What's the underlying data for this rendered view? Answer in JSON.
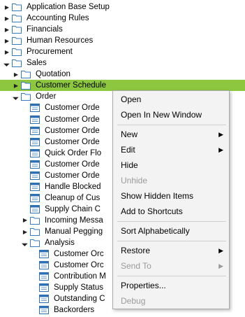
{
  "tree": [
    {
      "label": "Application Base Setup",
      "level": 0,
      "toggle": "collapsed",
      "icon": "folder"
    },
    {
      "label": "Accounting Rules",
      "level": 0,
      "toggle": "collapsed",
      "icon": "folder"
    },
    {
      "label": "Financials",
      "level": 0,
      "toggle": "collapsed",
      "icon": "folder"
    },
    {
      "label": "Human Resources",
      "level": 0,
      "toggle": "collapsed",
      "icon": "folder"
    },
    {
      "label": "Procurement",
      "level": 0,
      "toggle": "collapsed",
      "icon": "folder"
    },
    {
      "label": "Sales",
      "level": 0,
      "toggle": "expanded",
      "icon": "folder"
    },
    {
      "label": "Quotation",
      "level": 1,
      "toggle": "collapsed",
      "icon": "folder"
    },
    {
      "label": "Customer Schedule",
      "level": 1,
      "toggle": "collapsed",
      "icon": "folder",
      "selected": true
    },
    {
      "label": "Order",
      "level": 1,
      "toggle": "expanded",
      "icon": "folder"
    },
    {
      "label": "Customer Orde",
      "level": 2,
      "toggle": "none",
      "icon": "window"
    },
    {
      "label": "Customer Orde",
      "level": 2,
      "toggle": "none",
      "icon": "window"
    },
    {
      "label": "Customer Orde",
      "level": 2,
      "toggle": "none",
      "icon": "window"
    },
    {
      "label": "Customer Orde",
      "level": 2,
      "toggle": "none",
      "icon": "window"
    },
    {
      "label": "Quick Order Flo",
      "level": 2,
      "toggle": "none",
      "icon": "window"
    },
    {
      "label": "Customer Orde",
      "level": 2,
      "toggle": "none",
      "icon": "window"
    },
    {
      "label": "Customer Orde",
      "level": 2,
      "toggle": "none",
      "icon": "window"
    },
    {
      "label": "Handle Blocked",
      "level": 2,
      "toggle": "none",
      "icon": "window"
    },
    {
      "label": "Cleanup of Cus",
      "level": 2,
      "toggle": "none",
      "icon": "window"
    },
    {
      "label": "Supply Chain C",
      "level": 2,
      "toggle": "none",
      "icon": "window"
    },
    {
      "label": "Incoming Messa",
      "level": 2,
      "toggle": "collapsed",
      "icon": "folder"
    },
    {
      "label": "Manual Pegging",
      "level": 2,
      "toggle": "collapsed",
      "icon": "folder"
    },
    {
      "label": "Analysis",
      "level": 2,
      "toggle": "expanded",
      "icon": "folder"
    },
    {
      "label": "Customer Orc",
      "level": 3,
      "toggle": "none",
      "icon": "window"
    },
    {
      "label": "Customer Orc",
      "level": 3,
      "toggle": "none",
      "icon": "window"
    },
    {
      "label": "Contribution M",
      "level": 3,
      "toggle": "none",
      "icon": "window"
    },
    {
      "label": "Supply Status",
      "level": 3,
      "toggle": "none",
      "icon": "window"
    },
    {
      "label": "Outstanding C",
      "level": 3,
      "toggle": "none",
      "icon": "window"
    },
    {
      "label": "Backorders",
      "level": 3,
      "toggle": "none",
      "icon": "window"
    }
  ],
  "menu": [
    {
      "label": "Open",
      "disabled": false,
      "submenu": false
    },
    {
      "label": "Open In New Window",
      "disabled": false,
      "submenu": false
    },
    {
      "sep": true
    },
    {
      "label": "New",
      "disabled": false,
      "submenu": true
    },
    {
      "label": "Edit",
      "disabled": false,
      "submenu": true
    },
    {
      "label": "Hide",
      "disabled": false,
      "submenu": false
    },
    {
      "label": "Unhide",
      "disabled": true,
      "submenu": false
    },
    {
      "label": "Show Hidden Items",
      "disabled": false,
      "submenu": false
    },
    {
      "label": "Add to Shortcuts",
      "disabled": false,
      "submenu": false
    },
    {
      "sep": true
    },
    {
      "label": "Sort Alphabetically",
      "disabled": false,
      "submenu": false
    },
    {
      "sep": true
    },
    {
      "label": "Restore",
      "disabled": false,
      "submenu": true
    },
    {
      "label": "Send To",
      "disabled": true,
      "submenu": true
    },
    {
      "sep": true
    },
    {
      "label": "Properties...",
      "disabled": false,
      "submenu": false
    },
    {
      "label": "Debug",
      "disabled": true,
      "submenu": false
    }
  ],
  "colors": {
    "selection": "#8dc63f",
    "folder_stroke": "#3a7bbf",
    "window_header": "#2f6fb3"
  }
}
